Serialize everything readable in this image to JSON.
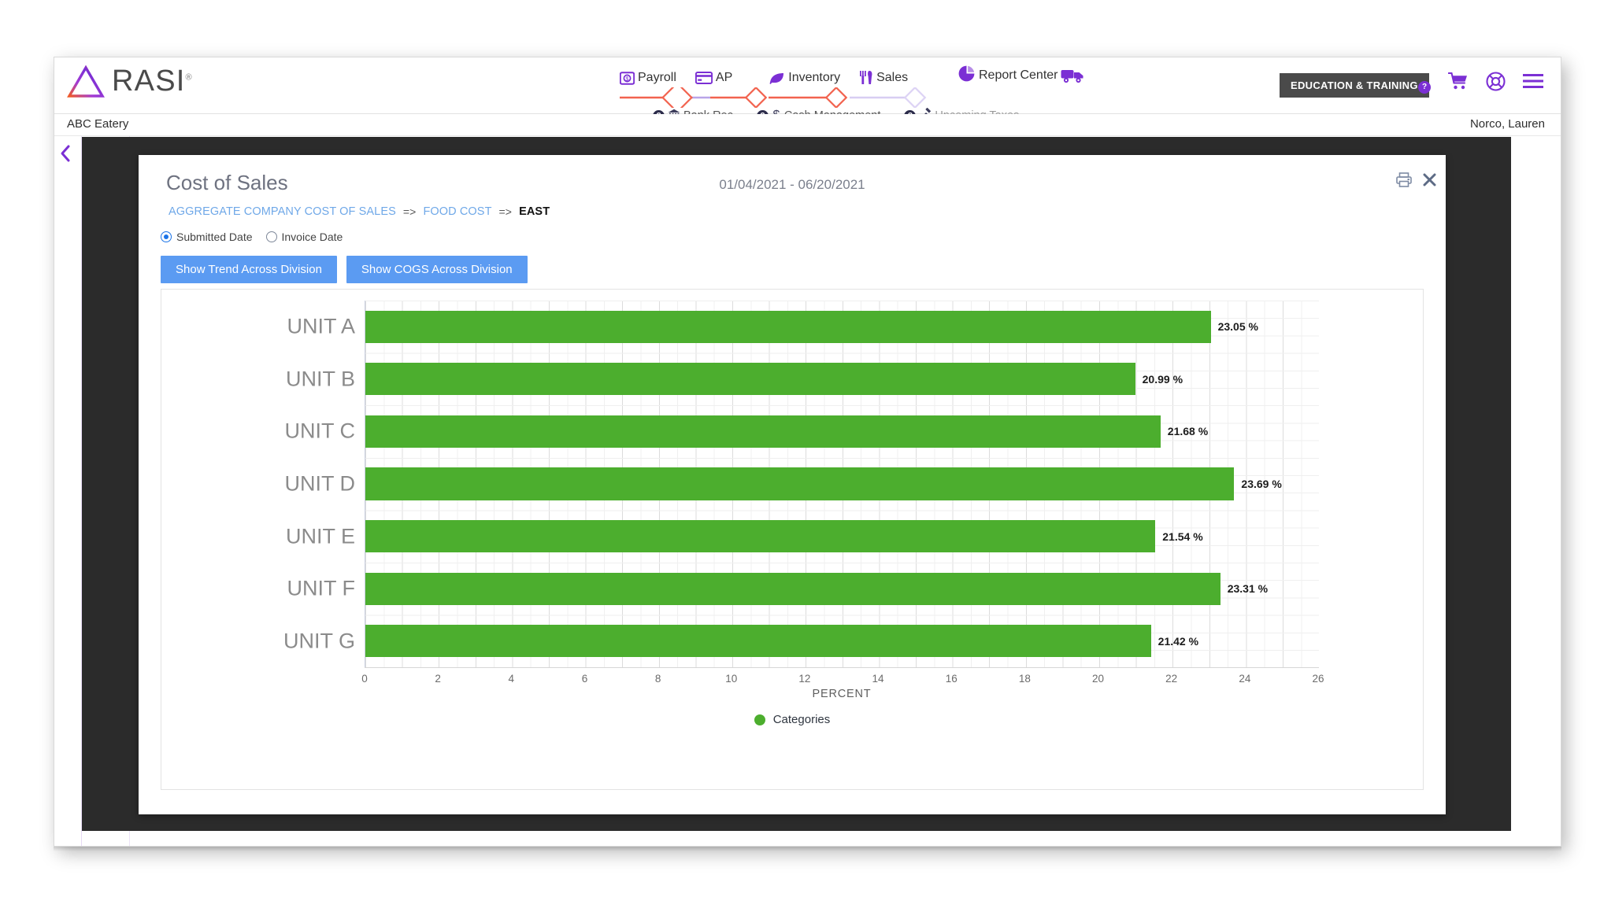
{
  "header": {
    "logo_text": "RASI",
    "logo_registered": "®",
    "company": "ABC Eatery",
    "user": "Norco, Lauren",
    "education_badge": "EDUCATION & TRAINING",
    "nav": [
      {
        "label": "Payroll",
        "icon": "payroll-money-icon"
      },
      {
        "label": "AP",
        "icon": "credit-card-icon"
      },
      {
        "label": "Inventory",
        "icon": "leaf-icon"
      },
      {
        "label": "Sales",
        "icon": "cutlery-icon"
      }
    ],
    "report_center": {
      "label": "Report Center",
      "icon": "pie-chart-icon"
    },
    "truck": {
      "icon": "delivery-truck-icon"
    },
    "subnav": [
      {
        "label": "Bank Rec",
        "icon": "bank-icon",
        "dim": false
      },
      {
        "label": "Cash Management",
        "icon": "dollar-icon",
        "dim": false
      },
      {
        "label": "Upcoming Taxes",
        "icon": "gavel-icon",
        "dim": true
      }
    ],
    "right_icons": [
      {
        "name": "notification-badge-icon",
        "glyph": "?"
      },
      {
        "name": "shopping-cart-icon"
      },
      {
        "name": "lifebuoy-support-icon"
      },
      {
        "name": "hamburger-menu-icon"
      }
    ]
  },
  "sidebar": {
    "collapse_icon": "chevron-left-icon",
    "menu_icon": "hamburger-menu-icon"
  },
  "panel": {
    "title": "Cost of Sales",
    "date_range": "01/04/2021 - 06/20/2021",
    "print_icon": "printer-icon",
    "close_icon": "close-x-icon",
    "breadcrumb": {
      "items": [
        {
          "label": "AGGREGATE COMPANY COST OF SALES",
          "type": "link"
        },
        {
          "label": "=>",
          "type": "separator"
        },
        {
          "label": "FOOD COST",
          "type": "link"
        },
        {
          "label": "=>",
          "type": "separator"
        },
        {
          "label": "EAST",
          "type": "current"
        }
      ]
    },
    "radios": [
      {
        "label": "Submitted Date",
        "selected": true
      },
      {
        "label": "Invoice Date",
        "selected": false
      }
    ],
    "buttons": [
      {
        "label": "Show Trend Across Division"
      },
      {
        "label": "Show COGS Across Division"
      }
    ]
  },
  "chart_data": {
    "type": "bar",
    "orientation": "horizontal",
    "title": "",
    "categories": [
      "UNIT A",
      "UNIT B",
      "UNIT C",
      "UNIT D",
      "UNIT E",
      "UNIT F",
      "UNIT G"
    ],
    "values": [
      23.05,
      20.99,
      21.68,
      23.69,
      21.54,
      23.31,
      21.42
    ],
    "value_labels": [
      "23.05 %",
      "20.99 %",
      "21.68 %",
      "23.69 %",
      "21.54 %",
      "23.31 %",
      "21.42 %"
    ],
    "xlabel": "PERCENT",
    "ylabel": "",
    "xlim": [
      0,
      26
    ],
    "xticks": [
      0,
      2,
      4,
      6,
      8,
      10,
      12,
      14,
      16,
      18,
      20,
      22,
      24,
      26
    ],
    "xticklabels": [
      "0",
      "2",
      "4",
      "6",
      "8",
      "10",
      "12",
      "14",
      "16",
      "18",
      "20",
      "22",
      "24",
      "26"
    ],
    "grid": true,
    "legend": {
      "position": "bottom",
      "entries": [
        {
          "label": "Categories",
          "color": "#4cae2e"
        }
      ]
    },
    "series_color": "#4cae2e"
  },
  "colors": {
    "bar_green": "#4cae2e",
    "brand_purple": "#7b2fd4",
    "button_blue": "#5b9bf2",
    "link_blue": "#6fa8e8",
    "overlay_dark": "#2b2b2b",
    "badge_dark": "#4a4a4a"
  }
}
